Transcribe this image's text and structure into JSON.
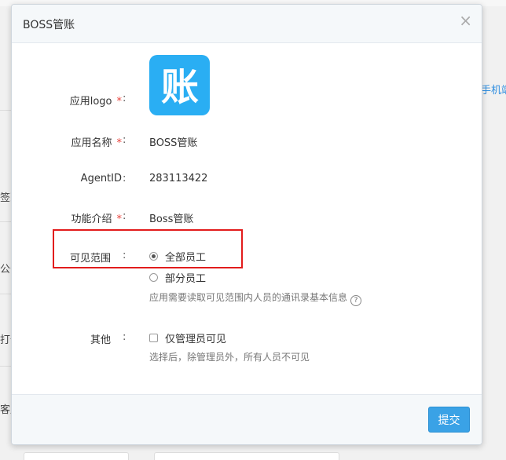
{
  "modal": {
    "title": "BOSS管账",
    "close_icon": "×",
    "submit_label": "提交"
  },
  "form": {
    "logo": {
      "label": "应用logo",
      "required": "*",
      "colon": ":",
      "glyph": "账"
    },
    "name": {
      "label": "应用名称",
      "required": "*",
      "colon": ":",
      "value": "BOSS管账"
    },
    "agent": {
      "label": "AgentID",
      "colon": ":",
      "value": "283113422"
    },
    "intro": {
      "label": "功能介绍",
      "required": "*",
      "colon": ":",
      "value": "Boss管账"
    },
    "visibility": {
      "label": "可见范围",
      "colon": ":",
      "options": [
        {
          "label": "全部员工",
          "checked": true
        },
        {
          "label": "部分员工",
          "checked": false
        }
      ],
      "hint": "应用需要读取可见范围内人员的通讯录基本信息",
      "help_icon": "?"
    },
    "other": {
      "label": "其他",
      "colon": ":",
      "checkbox_label": "仅管理员可见",
      "checked": false,
      "hint": "选择后，除管理员外，所有人员不可见"
    }
  },
  "background": {
    "right_link": "手机端",
    "left_labels": [
      "签到",
      "公告",
      "打卡",
      "客户"
    ]
  },
  "colors": {
    "accent": "#3aa2e6",
    "logo_bg": "#2aaef3",
    "required": "#e8413b",
    "highlight": "#e21c1c"
  }
}
